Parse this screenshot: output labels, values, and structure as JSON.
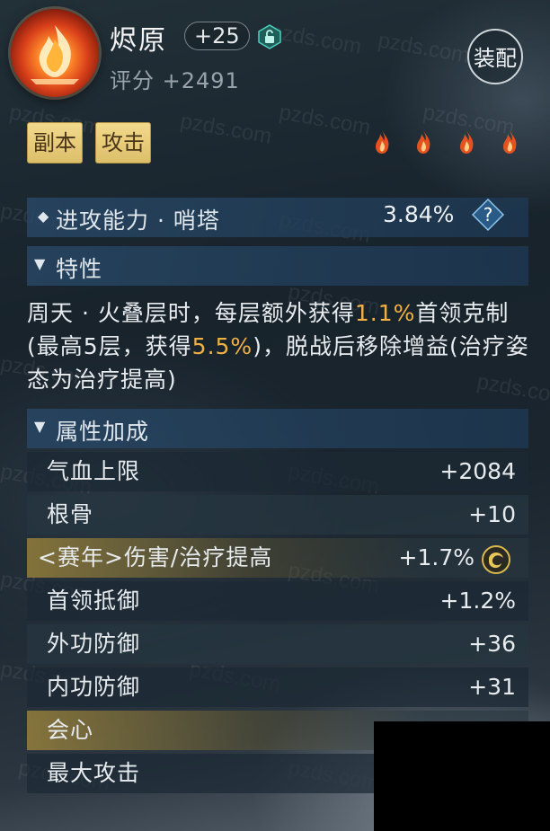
{
  "header": {
    "item_name": "烬原",
    "level_badge": "+25",
    "score": "评分 +2491",
    "equip_button": "装配"
  },
  "tags": [
    "副本",
    "攻击"
  ],
  "attack_section": {
    "title": "进攻能力 · 哨塔",
    "value": "3.84%",
    "help_icon": "?"
  },
  "traits": {
    "title": "特性",
    "desc_parts": [
      "周天 · 火叠层时，每层额外获得",
      "1.1%",
      "首领克制(最高5层，获得",
      "5.5%",
      ")，脱战后移除增益(治疗姿态为治疗提高)"
    ]
  },
  "attributes": {
    "title": "属性加成",
    "rows": [
      {
        "label": "气血上限",
        "value": "+2084"
      },
      {
        "label": "根骨",
        "value": "+10"
      },
      {
        "label": "<赛年>伤害/治疗提高",
        "value": "+1.7%"
      },
      {
        "label": "首领抵御",
        "value": "+1.2%"
      },
      {
        "label": "外功防御",
        "value": "+36"
      },
      {
        "label": "内功防御",
        "value": "+31"
      },
      {
        "label": "会心",
        "value": ""
      },
      {
        "label": "最大攻击",
        "value": ""
      }
    ]
  },
  "watermark": "pzds.com",
  "colors": {
    "highlight": "#f0b043",
    "tag_bg": "#ddbf6a",
    "section_bar": "#284664"
  },
  "icons": [
    "flame-emblem-icon",
    "lock-icon",
    "flame-icon",
    "diamond-icon",
    "help-icon",
    "chevron-down-icon",
    "swirl-icon"
  ]
}
